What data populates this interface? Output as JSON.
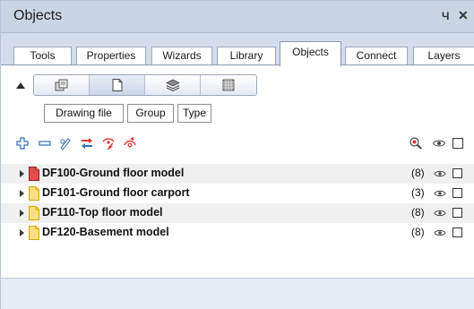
{
  "window": {
    "title": "Objects",
    "pin_glyph": "Ч",
    "close_glyph": "✕"
  },
  "tabs": [
    {
      "label": "Tools",
      "active": false
    },
    {
      "label": "Properties",
      "active": false
    },
    {
      "label": "Wizards",
      "active": false
    },
    {
      "label": "Library",
      "active": false
    },
    {
      "label": "Objects",
      "active": true
    },
    {
      "label": "Connect",
      "active": false
    },
    {
      "label": "Layers",
      "active": false
    }
  ],
  "view_toolbar": {
    "buttons": [
      {
        "icon": "structure-icon",
        "active": false
      },
      {
        "icon": "drawing-file-icon",
        "active": true
      },
      {
        "icon": "layers-icon",
        "active": false
      },
      {
        "icon": "grid-icon",
        "active": false
      }
    ]
  },
  "group_buttons": [
    {
      "label": "Drawing file"
    },
    {
      "label": "Group"
    },
    {
      "label": "Type"
    }
  ],
  "action_icons": [
    "add-icon",
    "remove-icon",
    "edit-icon",
    "move-icon",
    "hide-icon",
    "show-icon"
  ],
  "right_icons": [
    "search-icon",
    "eye-icon",
    "checkbox-icon"
  ],
  "rows": [
    {
      "label": "DF100-Ground floor model",
      "count": "(8)",
      "icon_color": "#e54b4b"
    },
    {
      "label": "DF101-Ground floor carport",
      "count": "(3)",
      "icon_color": "#f5c518"
    },
    {
      "label": "DF110-Top floor model",
      "count": "(8)",
      "icon_color": "#f5c518"
    },
    {
      "label": "DF120-Basement model",
      "count": "(8)",
      "icon_color": "#f5c518"
    }
  ],
  "colors": {
    "title_bar": "#cad5e4",
    "tab_strip": "#d3dcea",
    "accent_red": "#e54b4b",
    "accent_yellow": "#f5c518"
  }
}
